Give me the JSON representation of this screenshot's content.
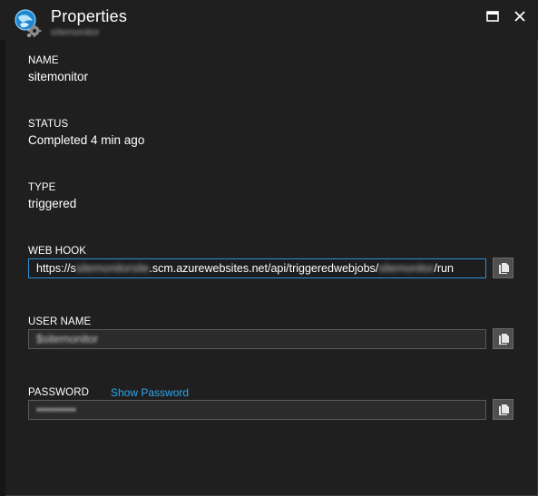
{
  "window": {
    "title": "Properties",
    "subtitle": "sitemonitor"
  },
  "properties": {
    "name_label": "NAME",
    "name_value": "sitemonitor",
    "status_label": "STATUS",
    "status_value": "Completed 4 min ago",
    "type_label": "TYPE",
    "type_value": "triggered",
    "webhook_label": "WEB HOOK",
    "webhook_prefix": "https://s",
    "webhook_blur1": "sitemonitorsite",
    "webhook_mid": ".scm.azurewebsites.net/api/triggeredwebjobs/",
    "webhook_blur2": "sitemonitor",
    "webhook_suffix": "/run",
    "username_label": "USER NAME",
    "username_value": "$sitemonitor",
    "password_label": "PASSWORD",
    "show_password": "Show Password",
    "password_value": "••••••••••"
  },
  "colors": {
    "background": "#1f1f1f",
    "accent": "#2ea8ef",
    "field_border": "#5a5a5a",
    "active_border": "#2b8fd6"
  },
  "icons": {
    "app": "webjob-gear-icon",
    "maximize": "maximize-icon",
    "close": "close-icon",
    "copy": "copy-icon"
  }
}
